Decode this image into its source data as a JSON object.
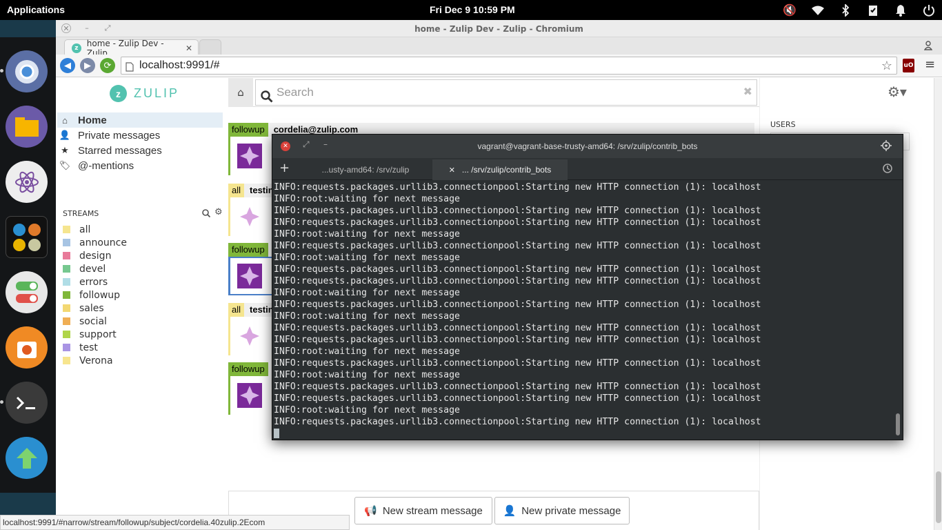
{
  "panel": {
    "applications": "Applications",
    "datetime": "Fri Dec  9   10:59 PM"
  },
  "browser": {
    "window_title": "home - Zulip Dev - Zulip - Chromium",
    "tab_title": "home - Zulip Dev - Zulip",
    "url": "localhost:9991/#",
    "status_url": "localhost:9991/#narrow/stream/followup/subject/cordelia.40zulip.2Ecom"
  },
  "zulip": {
    "logo_text": "ZULIP",
    "search_placeholder": "Search",
    "nav": [
      {
        "label": "Home"
      },
      {
        "label": "Private messages"
      },
      {
        "label": "Starred messages"
      },
      {
        "label": "@-mentions"
      }
    ],
    "streams_header": "STREAMS",
    "streams": [
      {
        "name": "all",
        "color": "#f5e58f"
      },
      {
        "name": "announce",
        "color": "#a7c4e3"
      },
      {
        "name": "design",
        "color": "#e87a9a"
      },
      {
        "name": "devel",
        "color": "#76c88f"
      },
      {
        "name": "errors",
        "color": "#b0dde6"
      },
      {
        "name": "followup",
        "color": "#80b73a"
      },
      {
        "name": "sales",
        "color": "#f3d873"
      },
      {
        "name": "social",
        "color": "#f0ae54"
      },
      {
        "name": "support",
        "color": "#b0d54a"
      },
      {
        "name": "test",
        "color": "#a994e4"
      },
      {
        "name": "Verona",
        "color": "#f7e58e"
      }
    ],
    "recipient_bars": [
      {
        "stream": "followup",
        "topic": "cordelia@zulip.com"
      },
      {
        "stream": "all",
        "topic": "testin"
      },
      {
        "stream": "followup",
        "topic": ""
      },
      {
        "stream": "all",
        "topic": "testin"
      },
      {
        "stream": "followup",
        "topic": ""
      }
    ],
    "users_header": "USERS",
    "compose": {
      "new_stream": "New stream message",
      "new_private": "New private message"
    }
  },
  "terminal": {
    "title": "vagrant@vagrant-base-trusty-amd64: /srv/zulip/contrib_bots",
    "tabs": [
      {
        "label": "...usty-amd64: /srv/zulip"
      },
      {
        "label": "... /srv/zulip/contrib_bots"
      }
    ],
    "lines": [
      "INFO:requests.packages.urllib3.connectionpool:Starting new HTTP connection (1): localhost",
      "INFO:root:waiting for next message",
      "INFO:requests.packages.urllib3.connectionpool:Starting new HTTP connection (1): localhost",
      "INFO:requests.packages.urllib3.connectionpool:Starting new HTTP connection (1): localhost",
      "INFO:root:waiting for next message",
      "INFO:requests.packages.urllib3.connectionpool:Starting new HTTP connection (1): localhost",
      "INFO:root:waiting for next message",
      "INFO:requests.packages.urllib3.connectionpool:Starting new HTTP connection (1): localhost",
      "INFO:requests.packages.urllib3.connectionpool:Starting new HTTP connection (1): localhost",
      "INFO:root:waiting for next message",
      "INFO:requests.packages.urllib3.connectionpool:Starting new HTTP connection (1): localhost",
      "INFO:root:waiting for next message",
      "INFO:requests.packages.urllib3.connectionpool:Starting new HTTP connection (1): localhost",
      "INFO:requests.packages.urllib3.connectionpool:Starting new HTTP connection (1): localhost",
      "INFO:root:waiting for next message",
      "INFO:requests.packages.urllib3.connectionpool:Starting new HTTP connection (1): localhost",
      "INFO:root:waiting for next message",
      "INFO:requests.packages.urllib3.connectionpool:Starting new HTTP connection (1): localhost",
      "INFO:requests.packages.urllib3.connectionpool:Starting new HTTP connection (1): localhost",
      "INFO:root:waiting for next message",
      "INFO:requests.packages.urllib3.connectionpool:Starting new HTTP connection (1): localhost"
    ]
  }
}
